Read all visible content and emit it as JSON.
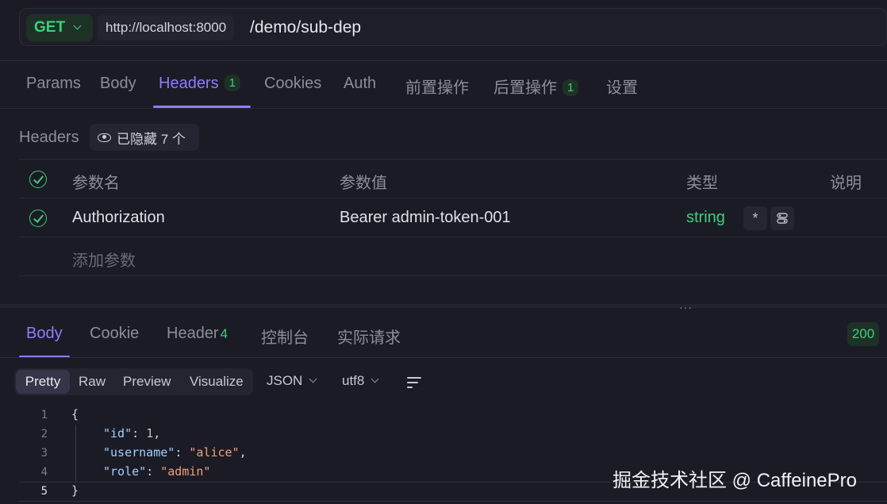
{
  "url_bar": {
    "method": "GET",
    "base_url": "http://localhost:8000",
    "path": "/demo/sub-dep"
  },
  "request_tabs": [
    {
      "label": "Params"
    },
    {
      "label": "Body"
    },
    {
      "label": "Headers",
      "badge": "1"
    },
    {
      "label": "Cookies"
    },
    {
      "label": "Auth"
    },
    {
      "label": "前置操作"
    },
    {
      "label": "后置操作",
      "badge": "1"
    },
    {
      "label": "设置"
    }
  ],
  "headers_section": {
    "label": "Headers",
    "hidden_chip": "已隐藏 7 个",
    "columns": [
      "参数名",
      "参数值",
      "类型",
      "说明"
    ],
    "rows": [
      {
        "enabled": true,
        "name": "Authorization",
        "value": "Bearer admin-token-001",
        "type": "string",
        "required_mark": "*"
      }
    ],
    "add_param": "添加参数"
  },
  "response_tabs": [
    {
      "label": "Body"
    },
    {
      "label": "Cookie"
    },
    {
      "label": "Header",
      "badge": "4"
    },
    {
      "label": "控制台"
    },
    {
      "label": "实际请求"
    }
  ],
  "status_code": "200",
  "view_modes": [
    "Pretty",
    "Raw",
    "Preview",
    "Visualize"
  ],
  "format": "JSON",
  "encoding": "utf8",
  "code": {
    "line_numbers": [
      "1",
      "2",
      "3",
      "4",
      "5"
    ],
    "open_brace": "{",
    "close_brace": "}",
    "entries": [
      {
        "key": "\"id\"",
        "value": "1"
      },
      {
        "key": "\"username\"",
        "value": "\"alice\""
      },
      {
        "key": "\"role\"",
        "value": "\"admin\""
      }
    ]
  },
  "watermark": "掘金技术社区 @ CaffeinePro",
  "colors": {
    "background": "#1b1b25",
    "accent": "#8f7cff",
    "success": "#3ecf7a",
    "string_value": "#f0a07a",
    "json_key": "#9fd0ff"
  }
}
